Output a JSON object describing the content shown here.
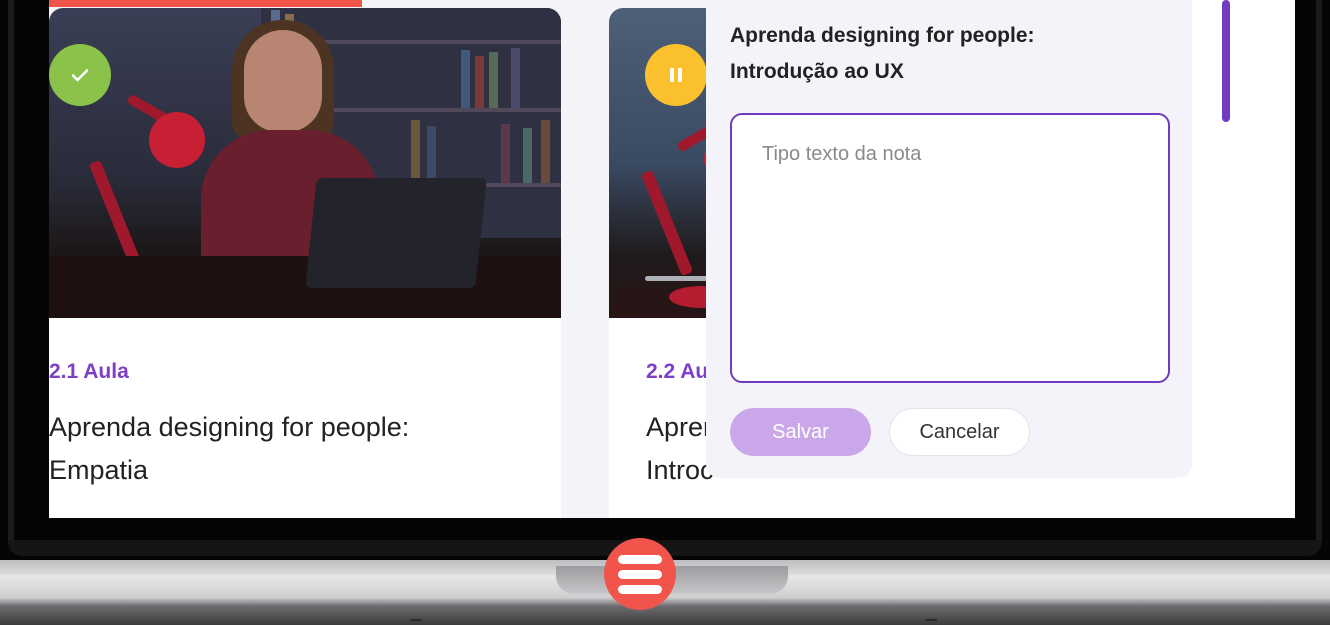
{
  "app": {
    "brand_color": "#f0544a",
    "accent_color": "#6f3bc2"
  },
  "lessons": [
    {
      "number": "2.1 Aula",
      "title": "Aprenda designing for people: Empatia",
      "status": "completed",
      "status_icon": "check-icon"
    },
    {
      "number": "2.2 Au",
      "title": "Aprer Introc",
      "title_line1": "Aprer",
      "title_line2": "Introc",
      "status": "paused",
      "status_icon": "pause-icon"
    }
  ],
  "notes": {
    "lesson_title": "Aprenda designing for people: Introdução ao UX",
    "title_line1": "Aprenda designing for people:",
    "title_line2": "Introdução ao UX",
    "textarea_placeholder": "Tipo texto da nota",
    "save_label": "Salvar",
    "cancel_label": "Cancelar"
  },
  "device": {
    "logo_icon": "menu-lines-logo"
  }
}
